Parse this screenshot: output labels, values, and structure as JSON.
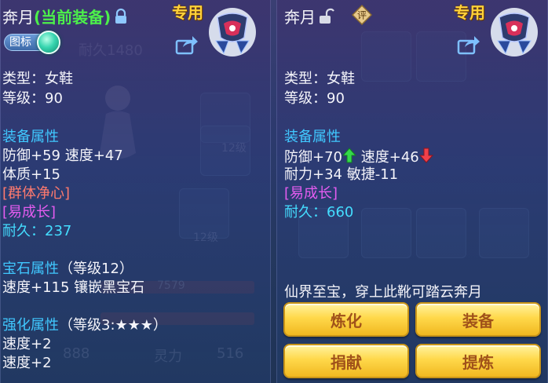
{
  "left_panel": {
    "item_name": "奔月",
    "equip_status": "(当前装备)",
    "exclusive_tag": "专用",
    "icon_toggle_label": "图标",
    "type_line": "类型：女鞋",
    "level_line": "等级：90",
    "equip_attr_title": "装备属性",
    "attr_line1": "防御+59 速度+47",
    "attr_line2": "体质+15",
    "special1": "[群体净心]",
    "special2": "[易成长]",
    "durability_label": "耐久：",
    "durability_value": "237",
    "gem_title": "宝石属性",
    "gem_level": "（等级12）",
    "gem_line": "速度+115 镶嵌黑宝石",
    "enhance_title": "强化属性",
    "enhance_level": "（等级3:★★★）",
    "enhance_line1": "速度+2",
    "enhance_line2": "速度+2"
  },
  "right_panel": {
    "item_name": "奔月",
    "rating_badge": "评",
    "exclusive_tag": "专用",
    "type_line": "类型：女鞋",
    "level_line": "等级：90",
    "equip_attr_title": "装备属性",
    "attr_def": "防御+70",
    "attr_spd": "速度+46",
    "attr_line2": "耐力+34 敏捷-11",
    "special1": "[易成长]",
    "durability_label": "耐久：",
    "durability_value": "660",
    "description": "仙界至宝，穿上此靴可踏云奔月",
    "buttons": {
      "refine": "炼化",
      "equip": "装备",
      "donate": "捐献",
      "extract": "提炼"
    }
  },
  "background": {
    "durability_hint": "耐久1480",
    "slot_level_a": "12级",
    "slot_level_b": "12级",
    "value_a": "7579",
    "value_b": "888",
    "spirit_label": "灵力",
    "spirit_value": "516"
  },
  "colors": {
    "section_blue": "#40c8ff",
    "orange_red": "#ff7a6e",
    "magenta": "#e45cf0",
    "cyan": "#44ddff",
    "up_green": "#34d84a",
    "down_red": "#f0404a",
    "button_gold": "#ffd84a"
  },
  "icons": [
    "lock-closed-icon",
    "lock-open-icon",
    "share-icon",
    "arrow-up-icon",
    "arrow-down-icon",
    "boots-item-icon",
    "rating-badge-icon"
  ]
}
